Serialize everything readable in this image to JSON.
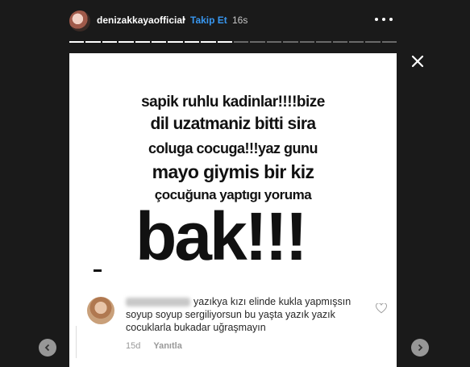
{
  "header": {
    "username": "denizakkayaofficial",
    "separator": "•",
    "follow_label": "Takip Et",
    "time": "16s"
  },
  "progress": {
    "segments_total": 20,
    "segments_done": 10
  },
  "story": {
    "lines": [
      "sapik ruhlu kadinlar!!!!bize",
      "dil uzatmaniz bitti sira",
      "coluga cocuga!!!yaz gunu",
      "mayo giymis bir kiz",
      "çocuğuna yaptıgı yoruma"
    ],
    "big_text": "bak!!!"
  },
  "comment": {
    "text": "yazıkya kızı elinde kukla yapmışsın soyup soyup sergiliyorsun bu yaşta yazık yazık cocuklarla bukadar uğraşmayın",
    "age": "15d",
    "reply_label": "Yanıtla"
  },
  "icons": {
    "close": "close-icon",
    "more": "more-horizontal-icon",
    "heart": "heart-icon",
    "prev": "chevron-left-icon",
    "next": "chevron-right-icon"
  },
  "colors": {
    "follow": "#3897f0",
    "background": "#1a1a1a"
  }
}
